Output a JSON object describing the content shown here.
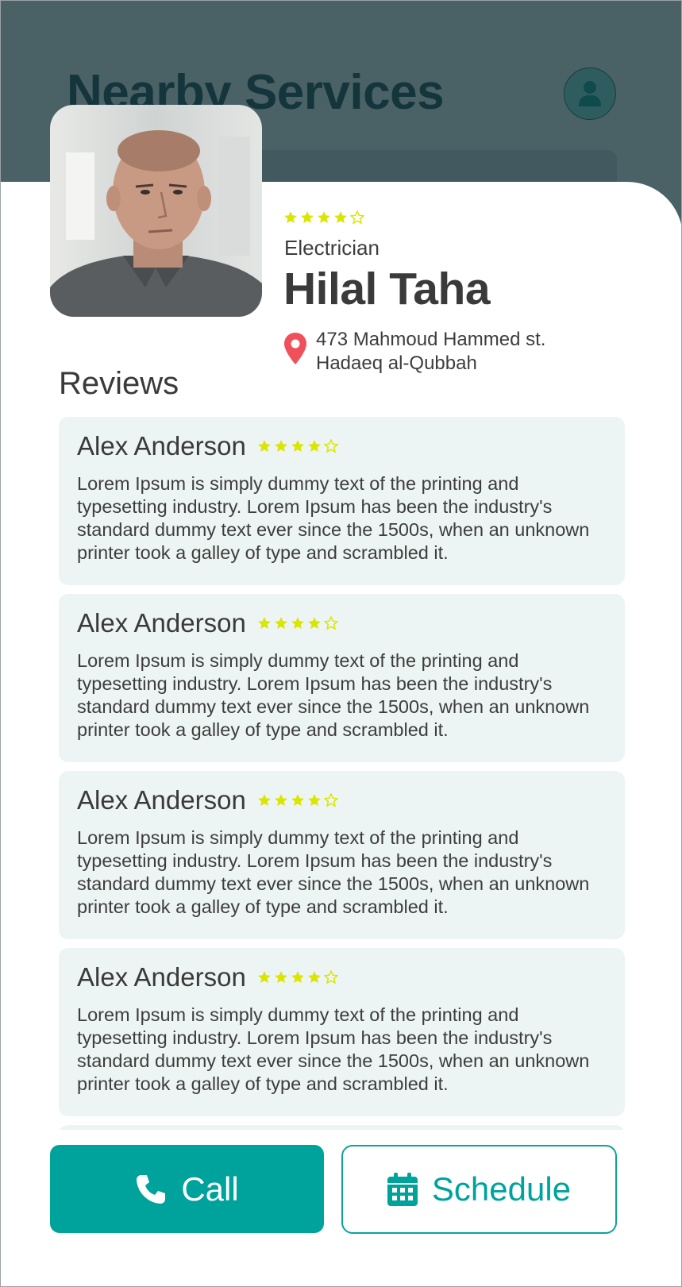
{
  "header": {
    "title": "Nearby Services",
    "profile_icon": "user-icon"
  },
  "worker": {
    "rating": 4,
    "rating_max": 5,
    "profession": "Electrician",
    "name": "Hilal Taha",
    "address_line1": "473 Mahmoud Hammed st.",
    "address_line2": "Hadaeq al-Qubbah",
    "location_icon": "map-pin-icon"
  },
  "reviews": {
    "title": "Reviews",
    "items": [
      {
        "author": "Alex Anderson",
        "rating": 4,
        "text": "Lorem Ipsum is simply dummy text of the printing and typesetting industry. Lorem Ipsum has been the industry's standard dummy text ever since the 1500s, when an unknown printer took a galley of type and scrambled it."
      },
      {
        "author": "Alex Anderson",
        "rating": 4,
        "text": "Lorem Ipsum is simply dummy text of the printing and typesetting industry. Lorem Ipsum has been the industry's standard dummy text ever since the 1500s, when an unknown printer took a galley of type and scrambled it."
      },
      {
        "author": "Alex Anderson",
        "rating": 4,
        "text": "Lorem Ipsum is simply dummy text of the printing and typesetting industry. Lorem Ipsum has been the industry's standard dummy text ever since the 1500s, when an unknown printer took a galley of type and scrambled it."
      },
      {
        "author": "Alex Anderson",
        "rating": 4,
        "text": "Lorem Ipsum is simply dummy text of the printing and typesetting industry. Lorem Ipsum has been the industry's standard dummy text ever since the 1500s, when an unknown printer took a galley of type and scrambled it."
      }
    ]
  },
  "actions": {
    "call_label": "Call",
    "call_icon": "phone-icon",
    "schedule_label": "Schedule",
    "schedule_icon": "calendar-icon"
  },
  "colors": {
    "accent": "#00a39c",
    "star": "#dbe500",
    "pin": "#f0505a",
    "review_bg": "#ecf5f3",
    "header_dim": "#4a6166"
  }
}
